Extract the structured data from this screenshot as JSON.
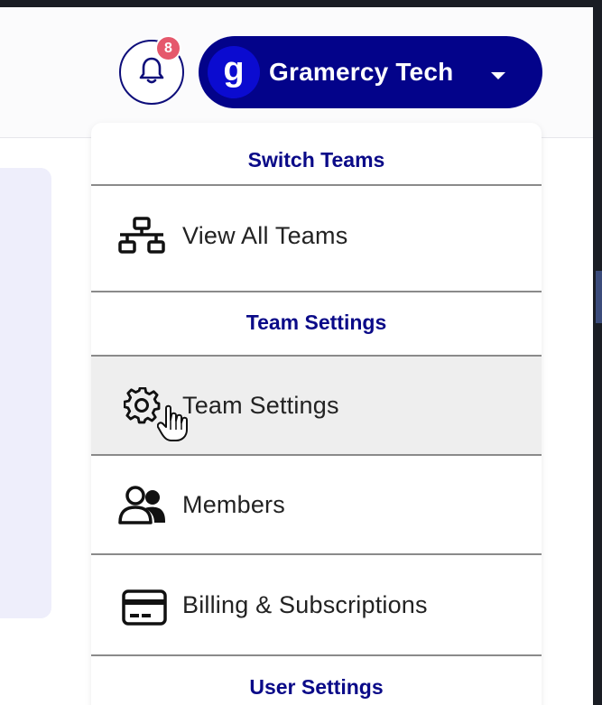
{
  "header": {
    "notifications": {
      "count": "8"
    },
    "team": {
      "avatar_letter": "g",
      "name": "Gramercy Tech"
    }
  },
  "dropdown": {
    "sections": [
      {
        "heading": "Switch Teams",
        "items": [
          {
            "label": "View All Teams",
            "icon": "sitemap-icon"
          }
        ]
      },
      {
        "heading": "Team Settings",
        "items": [
          {
            "label": "Team Settings",
            "icon": "gear-icon",
            "hovered": true
          },
          {
            "label": "Members",
            "icon": "users-icon"
          },
          {
            "label": "Billing & Subscriptions",
            "icon": "credit-card-icon"
          }
        ]
      },
      {
        "heading": "User Settings",
        "items": []
      }
    ]
  },
  "colors": {
    "brand_navy": "#03038a",
    "avatar_blue": "#0b0bd0",
    "badge_red": "#e5586c",
    "heading_navy": "#0a0a88",
    "hover_bg": "#eeeeee"
  }
}
